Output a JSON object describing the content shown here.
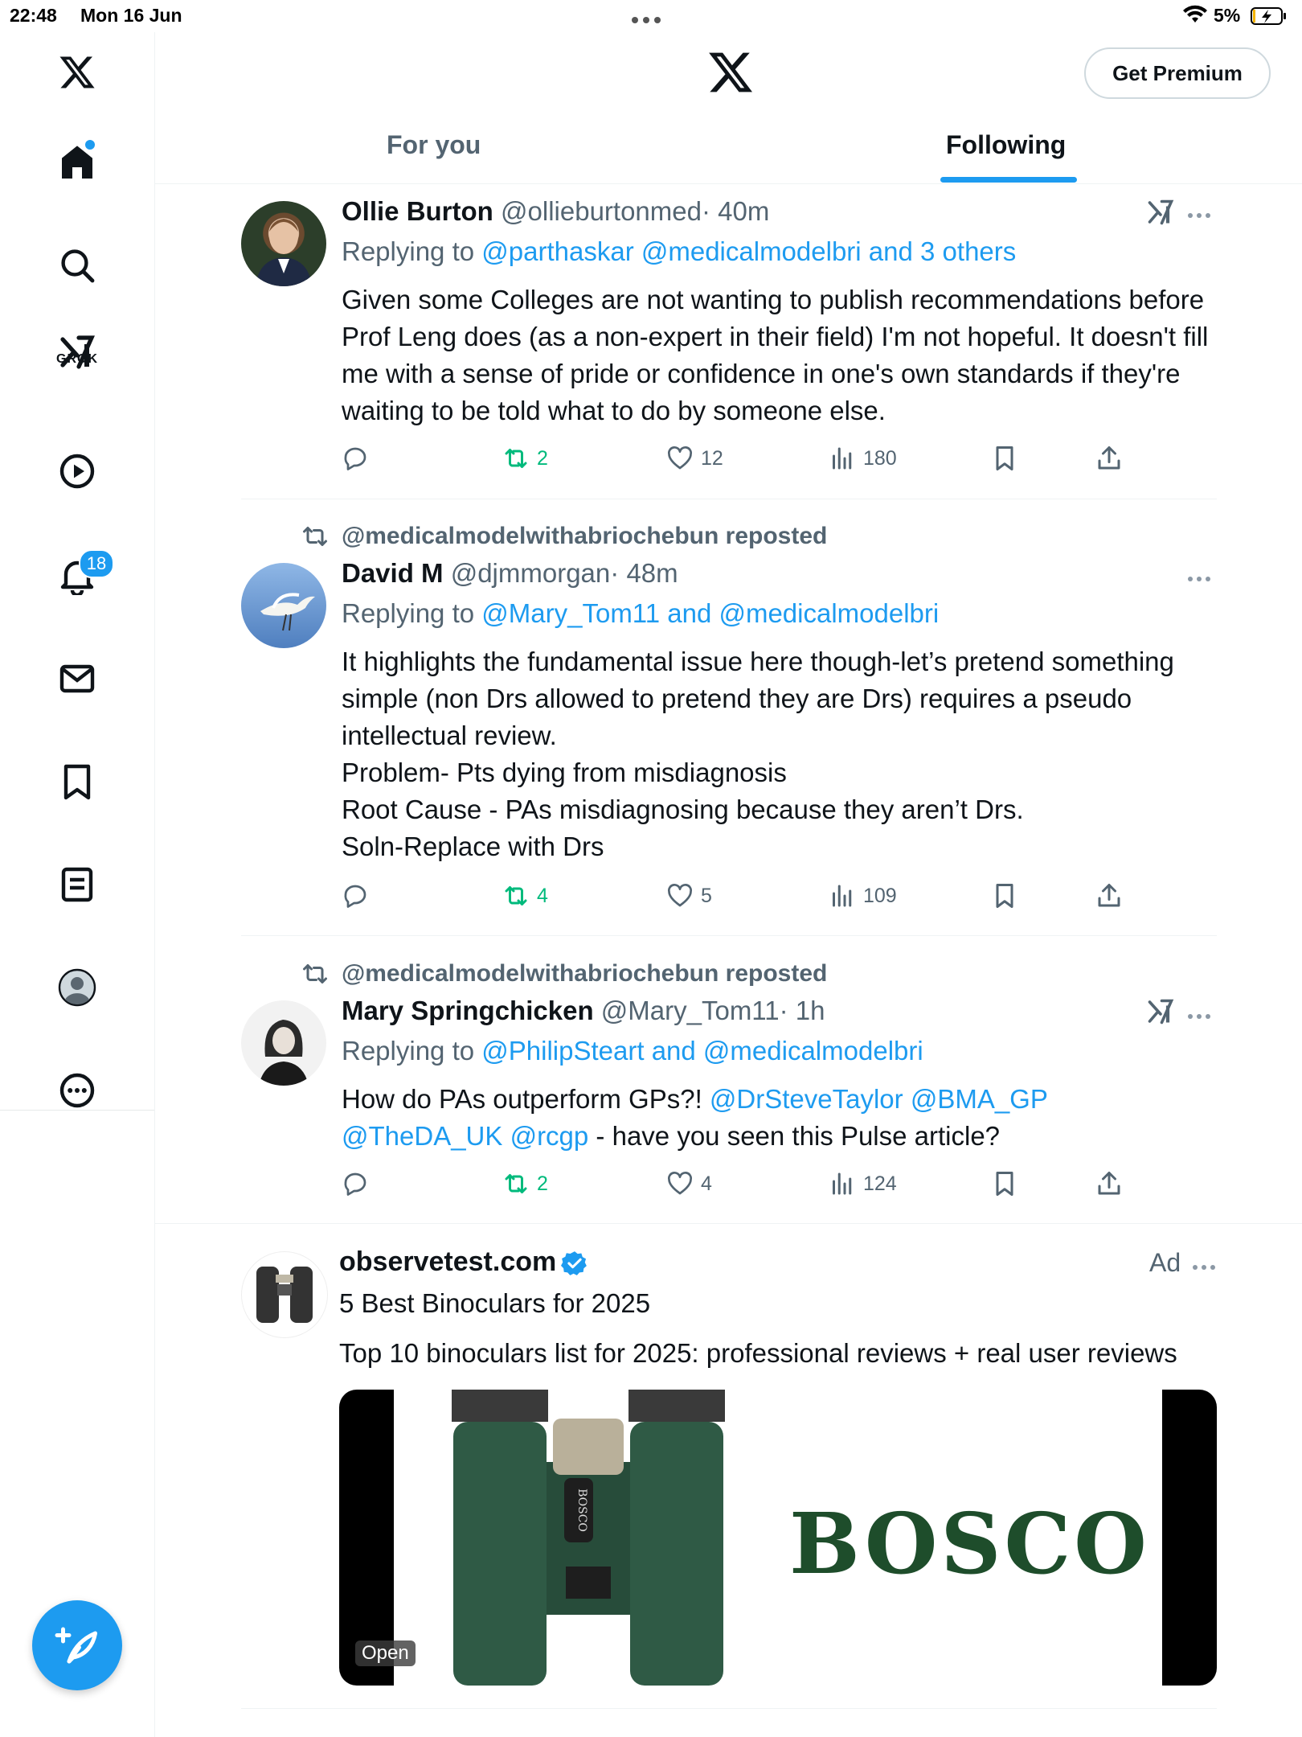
{
  "status_bar": {
    "time": "22:48",
    "date": "Mon 16 Jun",
    "battery": "5%"
  },
  "sidebar": {
    "grok_label": "GROK",
    "notifications_count": "18",
    "items": [
      "home",
      "explore",
      "grok",
      "video",
      "notifications",
      "messages",
      "bookmarks",
      "lists",
      "profile",
      "more"
    ]
  },
  "header": {
    "premium_label": "Get Premium",
    "tabs": [
      {
        "label": "For you",
        "active": false
      },
      {
        "label": "Following",
        "active": true
      }
    ]
  },
  "tweets": [
    {
      "name": "Ollie Burton",
      "handle": "@ollieburtonmed",
      "time": "· 40m",
      "replying_prefix": "Replying to",
      "replying_to": "@parthaskar @medicalmodelbri and 3 others",
      "body": "Given some Colleges are not wanting to publish recommendations before Prof Leng does (as a non-expert in their field) I'm not hopeful. It doesn't fill me with a sense of pride or confidence in one's own standards if they're waiting to be told what to do by someone else.",
      "reposts": "2",
      "likes": "12",
      "views": "180"
    },
    {
      "reposted_by": "@medicalmodelwithabriochebun reposted",
      "name": "David M",
      "handle": "@djmmorgan",
      "time": "· 48m",
      "replying_prefix": "Replying to",
      "replying_to": "@Mary_Tom11 and @medicalmodelbri",
      "body": "It highlights the fundamental issue here though-let’s pretend something simple (non Drs allowed to pretend they are Drs) requires a pseudo intellectual review.\nProblem- Pts dying from misdiagnosis\nRoot Cause - PAs misdiagnosing because they aren’t Drs.\nSoln-Replace with Drs",
      "reposts": "4",
      "likes": "5",
      "views": "109"
    },
    {
      "reposted_by": "@medicalmodelwithabriochebun reposted",
      "name": "Mary Springchicken",
      "handle": "@Mary_Tom11",
      "time": "· 1h",
      "replying_prefix": "Replying to",
      "replying_to": "@PhilipSteart and @medicalmodelbri",
      "body_mentions_1": "@DrSteveTaylor @BMA_GP",
      "body_prefix": "How do PAs outperform GPs?! ",
      "body_mentions_2": "@TheDA_UK @rcgp",
      "body_suffix": " - have you seen this Pulse article?",
      "reposts": "2",
      "likes": "4",
      "views": "124"
    }
  ],
  "ad": {
    "domain": "observetest.com",
    "label": "Ad",
    "title": "5 Best Binoculars for 2025",
    "description": "Top 10 binoculars list for 2025: professional reviews + real user reviews",
    "brand_text": "BOSCO",
    "open_label": "Open"
  },
  "colors": {
    "accent": "#1d9bf0",
    "repost_green": "#00ba7c",
    "muted": "#536471"
  }
}
